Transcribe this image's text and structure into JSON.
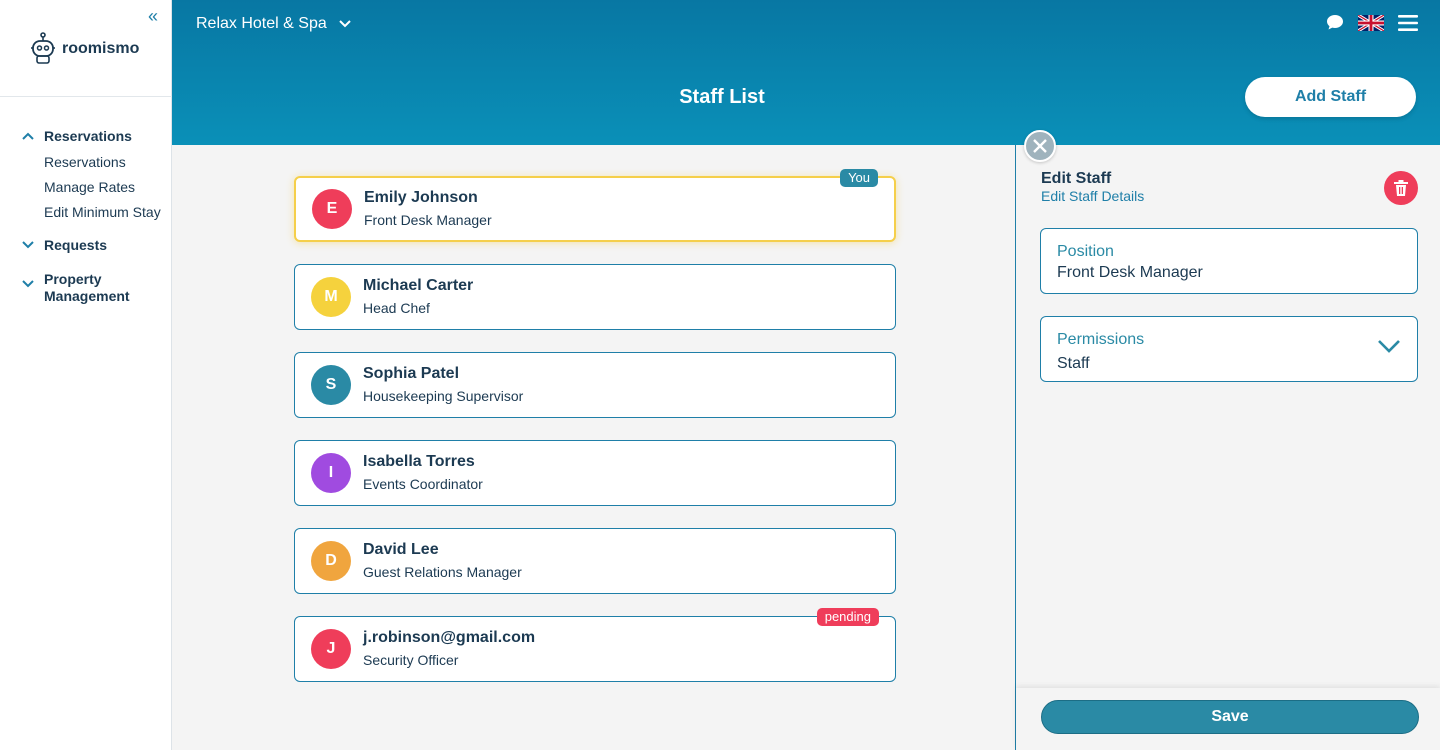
{
  "brand": {
    "name": "roomismo"
  },
  "sidebar": {
    "groups": [
      {
        "label": "Reservations",
        "expanded": true,
        "items": [
          "Reservations",
          "Manage Rates",
          "Edit Minimum Stay"
        ]
      },
      {
        "label": "Requests",
        "expanded": false,
        "items": []
      },
      {
        "label": "Property Management",
        "expanded": false,
        "items": []
      }
    ]
  },
  "header": {
    "hotel": "Relax Hotel & Spa",
    "title": "Staff List",
    "add_label": "Add Staff"
  },
  "staff": [
    {
      "initial": "E",
      "name": "Emily Johnson",
      "role": "Front Desk Manager",
      "color": "#ef3d5a",
      "badge": "You",
      "badge_color": "#2a8aa5",
      "selected": true
    },
    {
      "initial": "M",
      "name": "Michael Carter",
      "role": "Head Chef",
      "color": "#f5d23d",
      "badge": "",
      "badge_color": "",
      "selected": false
    },
    {
      "initial": "S",
      "name": "Sophia Patel",
      "role": "Housekeeping Supervisor",
      "color": "#2a8aa5",
      "badge": "",
      "badge_color": "",
      "selected": false
    },
    {
      "initial": "I",
      "name": "Isabella Torres",
      "role": "Events Coordinator",
      "color": "#a04be0",
      "badge": "",
      "badge_color": "",
      "selected": false
    },
    {
      "initial": "D",
      "name": "David Lee",
      "role": "Guest Relations Manager",
      "color": "#f0a53e",
      "badge": "",
      "badge_color": "",
      "selected": false
    },
    {
      "initial": "J",
      "name": "j.robinson@gmail.com",
      "role": "Security Officer",
      "color": "#ef3d5a",
      "badge": "pending",
      "badge_color": "#ef3d5a",
      "selected": false
    }
  ],
  "edit": {
    "title": "Edit Staff",
    "subtitle": "Edit Staff Details",
    "position_label": "Position",
    "position_value": "Front Desk Manager",
    "permissions_label": "Permissions",
    "permissions_value": "Staff",
    "save_label": "Save"
  }
}
